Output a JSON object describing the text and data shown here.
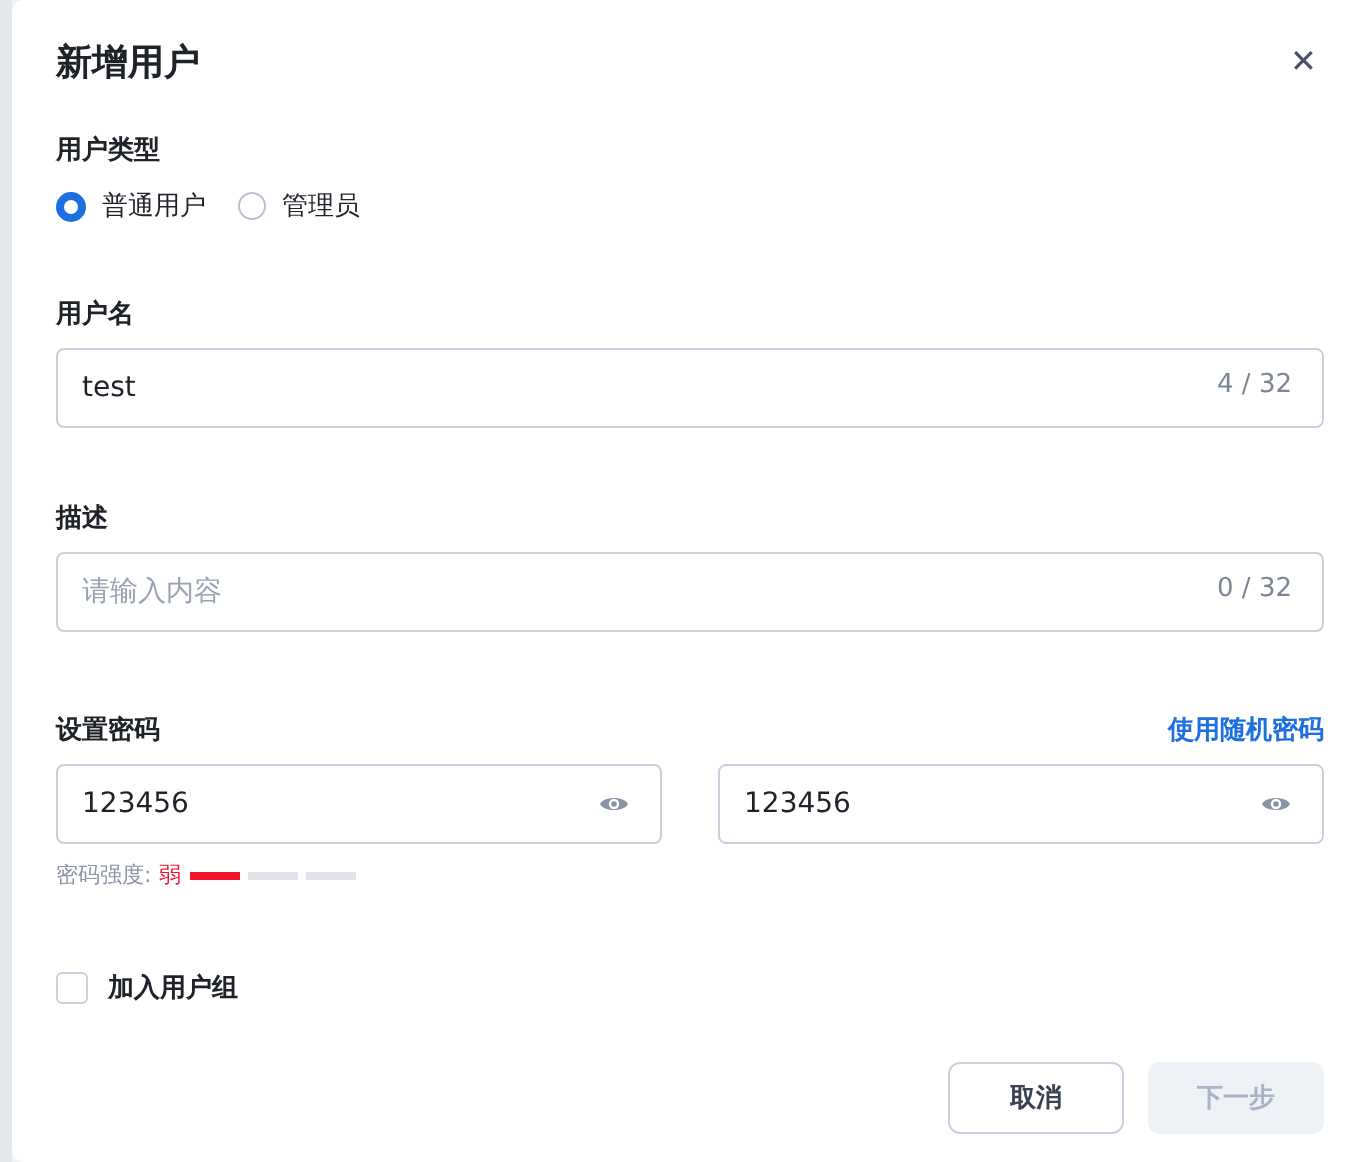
{
  "dialog": {
    "title": "新增用户",
    "close": "✕"
  },
  "user_type": {
    "label": "用户类型",
    "options": [
      {
        "label": "普通用户",
        "selected": true
      },
      {
        "label": "管理员",
        "selected": false
      }
    ]
  },
  "username": {
    "label": "用户名",
    "value": "test",
    "count": "4 / 32"
  },
  "description": {
    "label": "描述",
    "placeholder": "请输入内容",
    "count": "0 / 32"
  },
  "password": {
    "label": "设置密码",
    "link": "使用随机密码",
    "value": "123456",
    "confirm_value": "123456",
    "strength_label": "密码强度:",
    "strength_text": "弱",
    "level": 0.333
  },
  "join_group": {
    "label": "加入用户组",
    "checked": false
  },
  "buttons": [
    {
      "label": "取消",
      "disabled": false
    },
    {
      "label": "下一步",
      "disabled": true
    }
  ]
}
